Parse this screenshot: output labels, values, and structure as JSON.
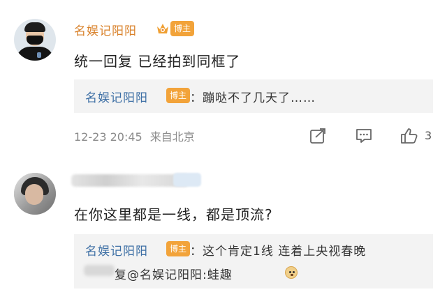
{
  "comments": [
    {
      "author": "名娱记阳阳",
      "author_badge": "博主",
      "vip_icon": "crown-vip-icon",
      "text": "统一回复 已经拍到同框了",
      "quote": {
        "author": "名娱记阳阳",
        "badge": "博主",
        "text": "：蹦哒不了几天了……"
      },
      "timestamp": "12-23 20:45",
      "location": "来自北京",
      "actions": [
        "share-icon",
        "comment-icon",
        "like-icon"
      ],
      "like_count": "3"
    },
    {
      "author": "",
      "text": "在你这里都是一线，都是顶流?",
      "quote": {
        "author": "名娱记阳阳",
        "badge": "博主",
        "text": "：这个肯定1线 连着上央视春晚",
        "reply_text": "复@名娱记阳阳:蛙趣"
      }
    }
  ],
  "colors": {
    "author": "#d9822b",
    "quote_author": "#3d6fa5",
    "badge": "#f2a33a",
    "quote_bg": "#f3f3f3",
    "meta": "#8a8a8a"
  }
}
